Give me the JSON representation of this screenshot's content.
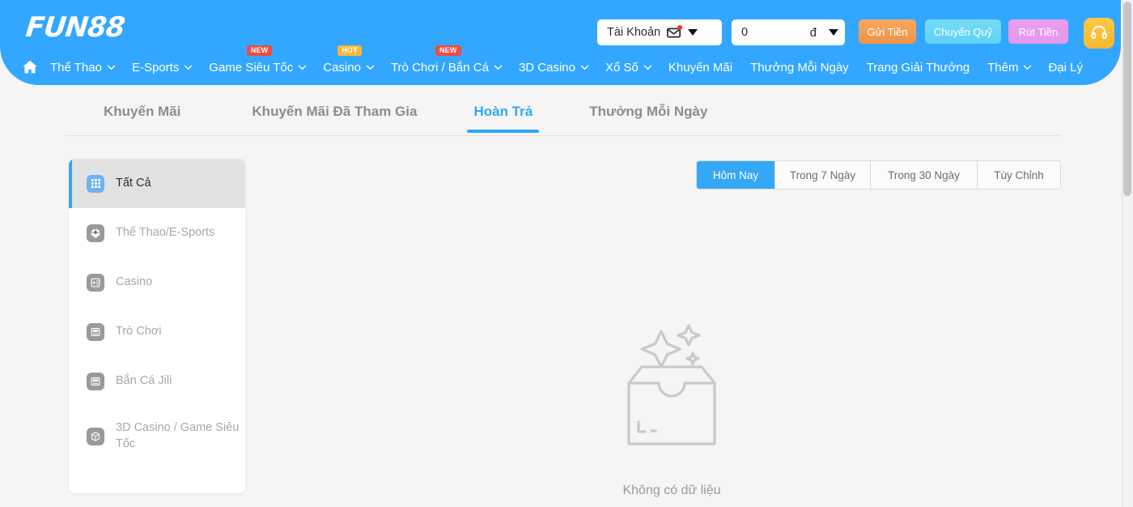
{
  "brand": {
    "logo_text": "FUN88",
    "header_color": "#33a7ff",
    "accent_color": "#2fa8f5"
  },
  "header": {
    "account_select": {
      "label": "Tài Khoản",
      "icon": "mail-icon",
      "has_notification": true
    },
    "balance_select": {
      "value": "0",
      "currency": "đ"
    },
    "buttons": [
      {
        "label": "Gửi Tiền",
        "color": "#f09348"
      },
      {
        "label": "Chuyển Quỹ",
        "color": "#5fd2f5"
      },
      {
        "label": "Rút Tiền",
        "color": "#e598ef"
      }
    ],
    "support_button": {
      "icon": "headset-icon",
      "color": "#f7b82f"
    }
  },
  "nav": {
    "home_icon": "home-icon",
    "items": [
      {
        "label": "Thể Thao",
        "caret": true,
        "badge": null
      },
      {
        "label": "E-Sports",
        "caret": true,
        "badge": null
      },
      {
        "label": "Game Siêu Tốc",
        "caret": true,
        "badge": "NEW"
      },
      {
        "label": "Casino",
        "caret": true,
        "badge": "HOT"
      },
      {
        "label": "Trò Chơi / Bắn Cá",
        "caret": true,
        "badge": "NEW"
      },
      {
        "label": "3D Casino",
        "caret": true,
        "badge": null
      },
      {
        "label": "Xổ Số",
        "caret": true,
        "badge": null
      },
      {
        "label": "Khuyến Mãi",
        "caret": false,
        "badge": null
      },
      {
        "label": "Thưởng Mỗi Ngày",
        "caret": false,
        "badge": null
      },
      {
        "label": "Trang Giải Thưởng",
        "caret": false,
        "badge": null
      },
      {
        "label": "Thêm",
        "caret": true,
        "badge": null
      },
      {
        "label": "Đại Lý",
        "caret": false,
        "badge": null
      }
    ]
  },
  "tabs": [
    {
      "label": "Khuyến Mãi",
      "active": false
    },
    {
      "label": "Khuyến Mãi Đã Tham Gia",
      "active": false
    },
    {
      "label": "Hoàn Trả",
      "active": true
    },
    {
      "label": "Thưởng Mỗi Ngày",
      "active": false
    }
  ],
  "sidebar": {
    "items": [
      {
        "label": "Tất Cả",
        "icon": "grid-icon",
        "selected": true
      },
      {
        "label": "Thể Thao/E-Sports",
        "icon": "soccer-icon",
        "selected": false
      },
      {
        "label": "Casino",
        "icon": "cards-icon",
        "selected": false
      },
      {
        "label": "Trò Chơi",
        "icon": "slot-icon",
        "selected": false
      },
      {
        "label": "Bắn Cá Jili",
        "icon": "fishing-icon",
        "selected": false
      },
      {
        "label": "3D Casino / Game Siêu Tốc",
        "icon": "cube-3d-icon",
        "selected": false
      }
    ]
  },
  "date_filters": [
    {
      "label": "Hôm Nay",
      "active": true
    },
    {
      "label": "Trong 7 Ngày",
      "active": false
    },
    {
      "label": "Trong 30 Ngày",
      "active": false
    },
    {
      "label": "Tùy Chỉnh",
      "active": false
    }
  ],
  "empty_state": {
    "icon": "empty-box-icon",
    "text": "Không có dữ liệu"
  }
}
